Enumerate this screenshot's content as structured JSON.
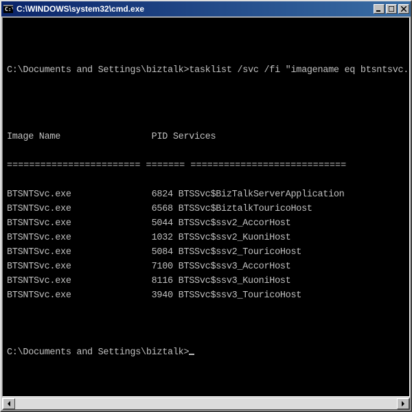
{
  "window": {
    "title": "C:\\WINDOWS\\system32\\cmd.exe"
  },
  "console": {
    "prompt1": "C:\\Documents and Settings\\biztalk>",
    "command": "tasklist /svc /fi \"imagename eq btsntsvc.exe\"",
    "col_image_name": "Image Name",
    "col_pid": "PID",
    "col_services": "Services",
    "sep_image": "========================",
    "sep_pid": "=======",
    "sep_services": "============================",
    "rows": [
      {
        "image": "BTSNTSvc.exe",
        "pid": "6824",
        "services": "BTSSvc$BizTalkServerApplication"
      },
      {
        "image": "BTSNTSvc.exe",
        "pid": "6568",
        "services": "BTSSvc$BiztalkTouricoHost"
      },
      {
        "image": "BTSNTSvc.exe",
        "pid": "5044",
        "services": "BTSSvc$ssv2_AccorHost"
      },
      {
        "image": "BTSNTSvc.exe",
        "pid": "1032",
        "services": "BTSSvc$ssv2_KuoniHost"
      },
      {
        "image": "BTSNTSvc.exe",
        "pid": "5084",
        "services": "BTSSvc$ssv2_TouricoHost"
      },
      {
        "image": "BTSNTSvc.exe",
        "pid": "7100",
        "services": "BTSSvc$ssv3_AccorHost"
      },
      {
        "image": "BTSNTSvc.exe",
        "pid": "8116",
        "services": "BTSSvc$ssv3_KuoniHost"
      },
      {
        "image": "BTSNTSvc.exe",
        "pid": "3940",
        "services": "BTSSvc$ssv3_TouricoHost"
      }
    ],
    "prompt2": "C:\\Documents and Settings\\biztalk>"
  }
}
